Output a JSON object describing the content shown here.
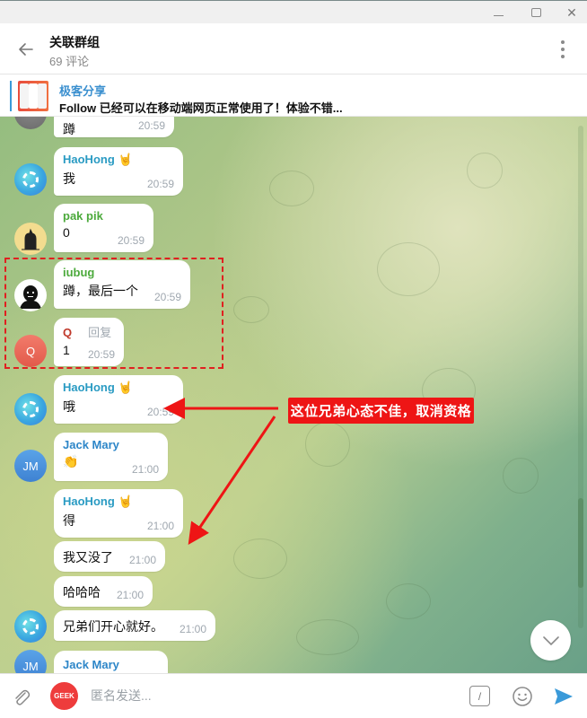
{
  "window": {
    "minimize_icon": "minimize-icon",
    "maximize_icon": "maximize-icon",
    "close_icon": "close-icon",
    "close_glyph": "✕"
  },
  "header": {
    "title": "关联群组",
    "subtitle": "69 评论",
    "back_icon": "arrow-left-icon",
    "more_icon": "more-vertical-icon"
  },
  "pinned": {
    "title": "极客分享",
    "text": "Follow 已经可以在移动端网页正常使用了！体验不错..."
  },
  "messages": [
    {
      "sender": "",
      "text": "蹲",
      "time": "20:59",
      "avatar": ""
    },
    {
      "sender": "HaoHong",
      "badge": "🤘",
      "text": "我",
      "time": "20:59",
      "avatar": ""
    },
    {
      "sender": "pak pik",
      "text": "0",
      "time": "20:59",
      "avatar": ""
    },
    {
      "sender": "iubug",
      "text": "蹲，最后一个",
      "time": "20:59",
      "avatar": ""
    },
    {
      "sender": "Q",
      "reply_label": "回复",
      "text": "1",
      "time": "20:59",
      "avatar": "Q"
    },
    {
      "sender": "HaoHong",
      "badge": "🤘",
      "text": "哦",
      "time": "20:59",
      "avatar": ""
    },
    {
      "sender": "Jack Mary",
      "text": "👏",
      "time": "21:00",
      "avatar": "JM"
    },
    {
      "sender": "HaoHong",
      "badge": "🤘",
      "text": "得",
      "time": "21:00",
      "avatar": ""
    },
    {
      "sender": "",
      "text": "我又没了",
      "time": "21:00",
      "avatar": ""
    },
    {
      "sender": "",
      "text": "哈哈哈",
      "time": "21:00",
      "avatar": ""
    },
    {
      "sender": "",
      "text": "兄弟们开心就好。",
      "time": "21:00",
      "avatar": ""
    },
    {
      "sender": "Jack Mary",
      "text": "",
      "time": "",
      "avatar": "JM"
    }
  ],
  "colors": {
    "haohong": "#2a9bc3",
    "pakpik": "#4caa3c",
    "iubug": "#4caa3c",
    "q": "#c0392b",
    "jackmary": "#2d86c8",
    "annotation": "#ee1515",
    "accent": "#3a9ad9"
  },
  "annotation": {
    "text": "这位兄弟心态不佳，取消资格"
  },
  "composer": {
    "placeholder": "匿名发送...",
    "value": "",
    "avatar_label": "GEEK",
    "command_label": "/"
  }
}
